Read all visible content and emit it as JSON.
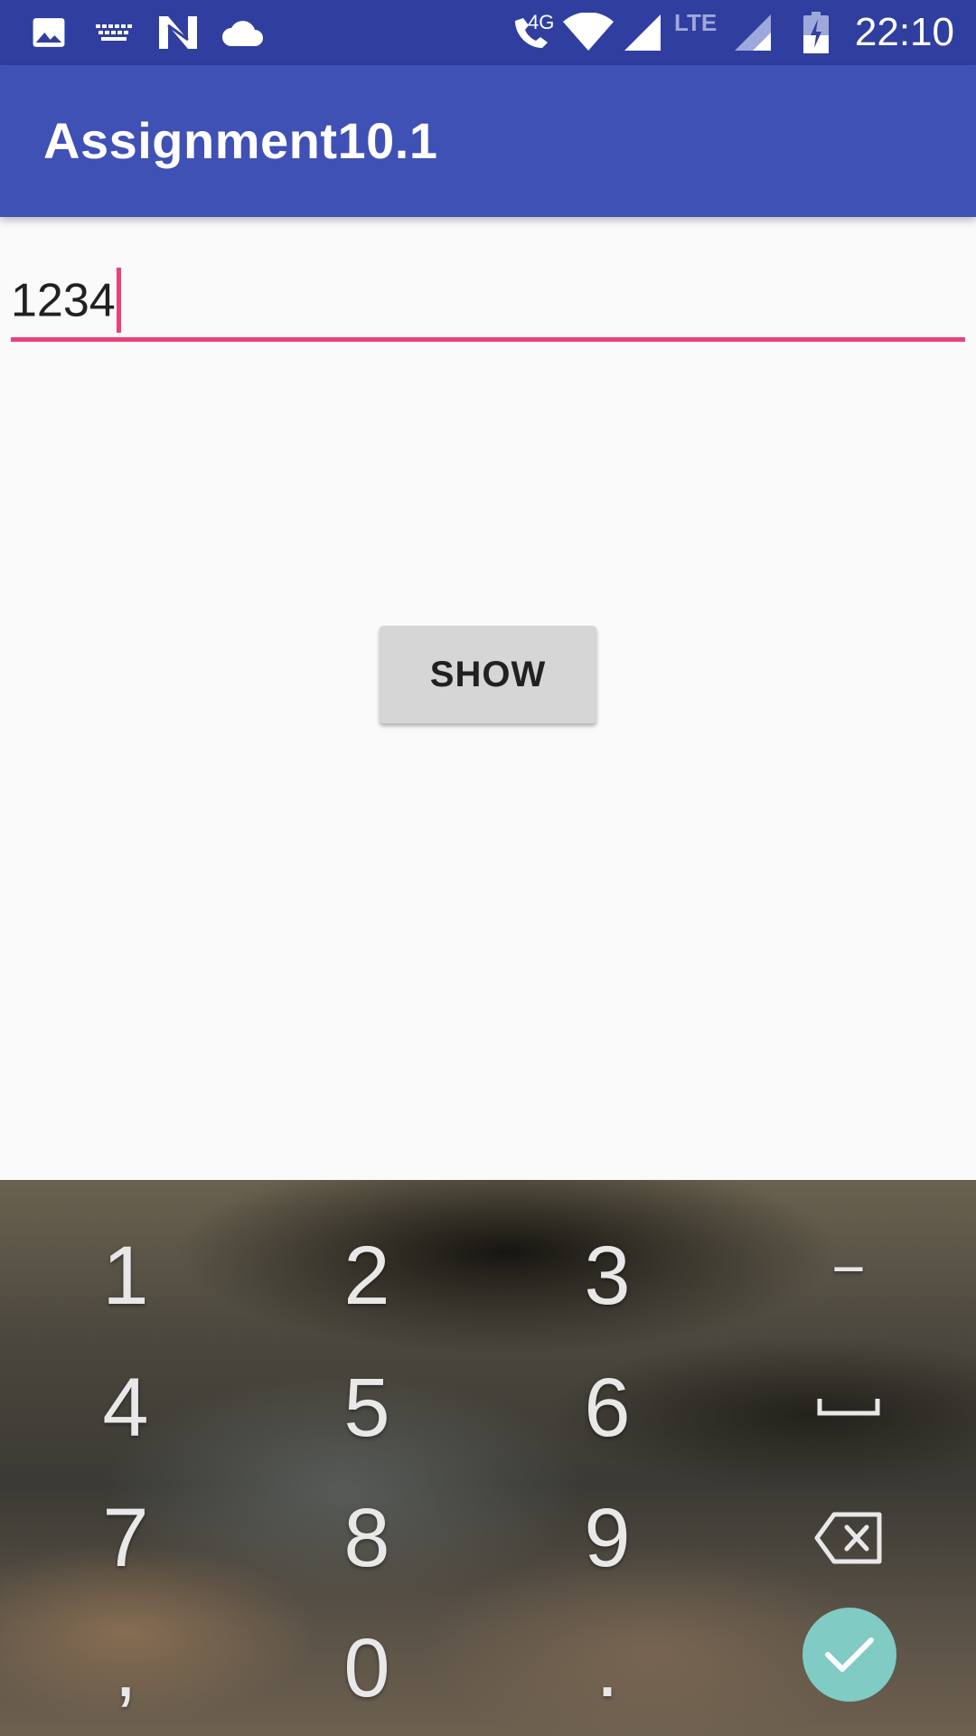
{
  "status_bar": {
    "time": "22:10",
    "network_label": "4G",
    "lte_label": "LTE",
    "icons": [
      "image-icon",
      "keyboard-icon",
      "n-icon",
      "cloud-icon",
      "wifi-call-icon",
      "wifi-icon",
      "signal-icon",
      "lte-signal-icon",
      "battery-charging-icon"
    ]
  },
  "app_bar": {
    "title": "Assignment10.1"
  },
  "input": {
    "value": "1234"
  },
  "button": {
    "label": "SHOW"
  },
  "keyboard": {
    "row1": [
      "1",
      "2",
      "3",
      "−"
    ],
    "row2": [
      "4",
      "5",
      "6"
    ],
    "row3": [
      "7",
      "8",
      "9"
    ],
    "row4": [
      ",",
      "0",
      "."
    ],
    "special_keys": [
      "space-key",
      "backspace-key",
      "done-key"
    ]
  },
  "colors": {
    "status_bar": "#303f9f",
    "app_bar": "#3f51b5",
    "accent": "#ec407a",
    "done_key": "#80cbc4"
  }
}
